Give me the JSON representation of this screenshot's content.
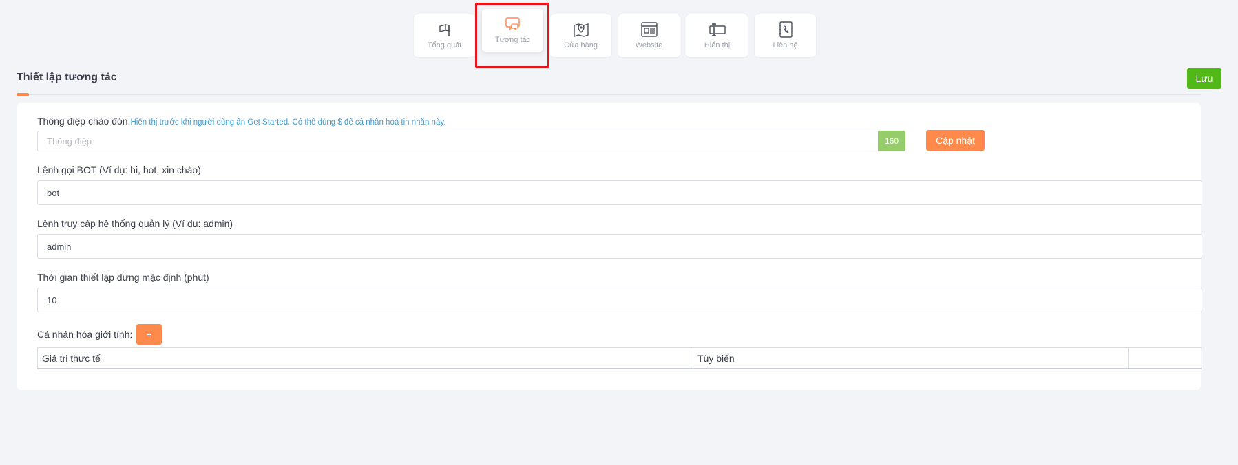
{
  "tabs": [
    {
      "label": "Tổng quát",
      "icon": "flag-icon",
      "active": false
    },
    {
      "label": "Tương tác",
      "icon": "chat-icon",
      "active": true
    },
    {
      "label": "Cửa hàng",
      "icon": "map-pin-icon",
      "active": false
    },
    {
      "label": "Website",
      "icon": "browser-icon",
      "active": false
    },
    {
      "label": "Hiển thị",
      "icon": "text-cursor-icon",
      "active": false
    },
    {
      "label": "Liên hệ",
      "icon": "phone-icon",
      "active": false
    }
  ],
  "header": {
    "title": "Thiết lập tương tác",
    "save_label": "Lưu"
  },
  "greeting": {
    "label": "Thông điệp chào đón:",
    "hint": "Hiển thị trước khi người dùng ấn Get Started. Có thể dùng $ để cá nhân hoá tin nhắn này.",
    "placeholder": "Thông điệp",
    "value": "",
    "counter": "160",
    "update_label": "Cập nhật"
  },
  "bot_command": {
    "label": "Lệnh gọi BOT (Ví dụ: hi, bot, xin chào)",
    "value": "bot"
  },
  "admin_command": {
    "label": "Lệnh truy cập hệ thống quản lý (Ví dụ: admin)",
    "value": "admin"
  },
  "pause_time": {
    "label": "Thời gian thiết lập dừng mặc định (phút)",
    "value": "10"
  },
  "gender": {
    "label": "Cá nhân hóa giới tính:",
    "add_label": "+",
    "columns": [
      "Giá trị thực tế",
      "Tùy biến",
      ""
    ]
  },
  "colors": {
    "accent": "#ff8a4c",
    "save": "#52b818",
    "counter": "#96cc6b",
    "hint": "#3ea0d8",
    "highlight": "#e8141b"
  }
}
